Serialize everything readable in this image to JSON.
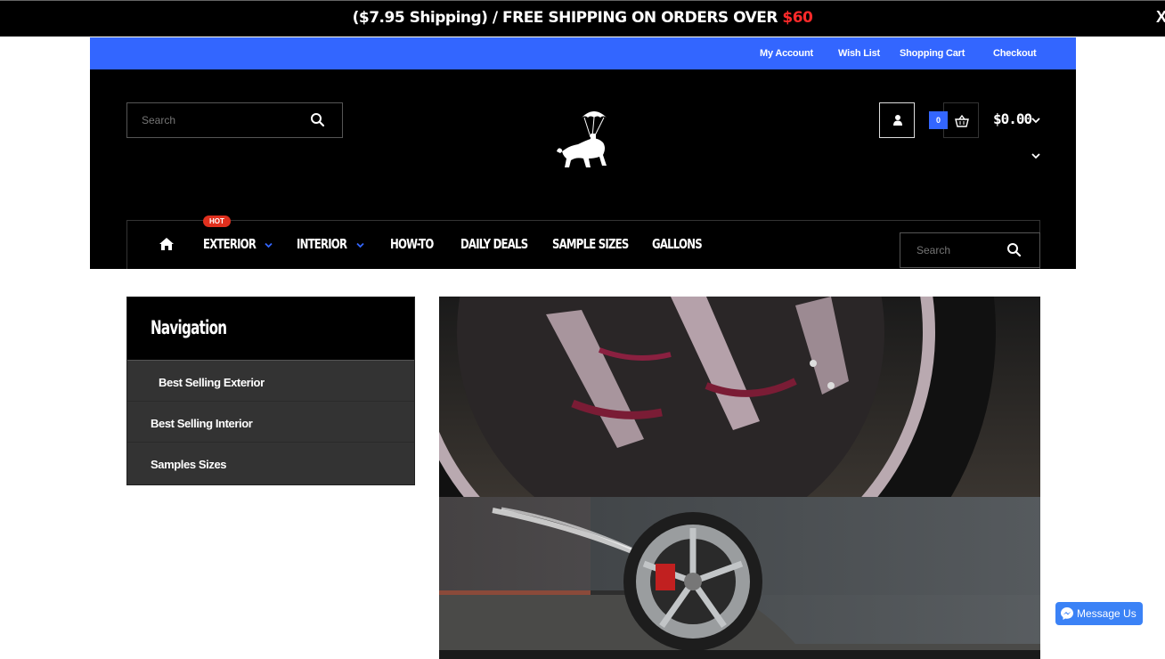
{
  "promo": {
    "text": "($7.95 Shipping) / FREE SHIPPING ON ORDERS OVER ",
    "amount": "$60",
    "close": "X"
  },
  "top_links": [
    "My Account",
    "Wish List",
    "Shopping Cart",
    "Checkout"
  ],
  "header": {
    "search_placeholder": "Search",
    "cart_count": "0",
    "cart_total": "$0.00"
  },
  "main_nav": {
    "items": [
      "EXTERIOR",
      "INTERIOR",
      "HOW-TO",
      "DAILY DEALS",
      "SAMPLE SIZES",
      "GALLONS"
    ],
    "hot_badge": "HOT",
    "search_placeholder": "Search"
  },
  "sidebar": {
    "title": "Navigation",
    "items": [
      "Best Selling Exterior",
      "Best Selling Interior",
      "Samples Sizes"
    ]
  },
  "messenger": {
    "label": "Message Us"
  },
  "icons": [
    "search-icon",
    "user-icon",
    "basket-icon",
    "chevron-down-icon",
    "home-icon",
    "messenger-icon",
    "close-icon"
  ],
  "colors": {
    "accent": "#3366ff",
    "promo_highlight": "#ff2a2a",
    "hot": "#e0301e",
    "header_bg": "#000000",
    "sidebar_bg": "#333333"
  }
}
